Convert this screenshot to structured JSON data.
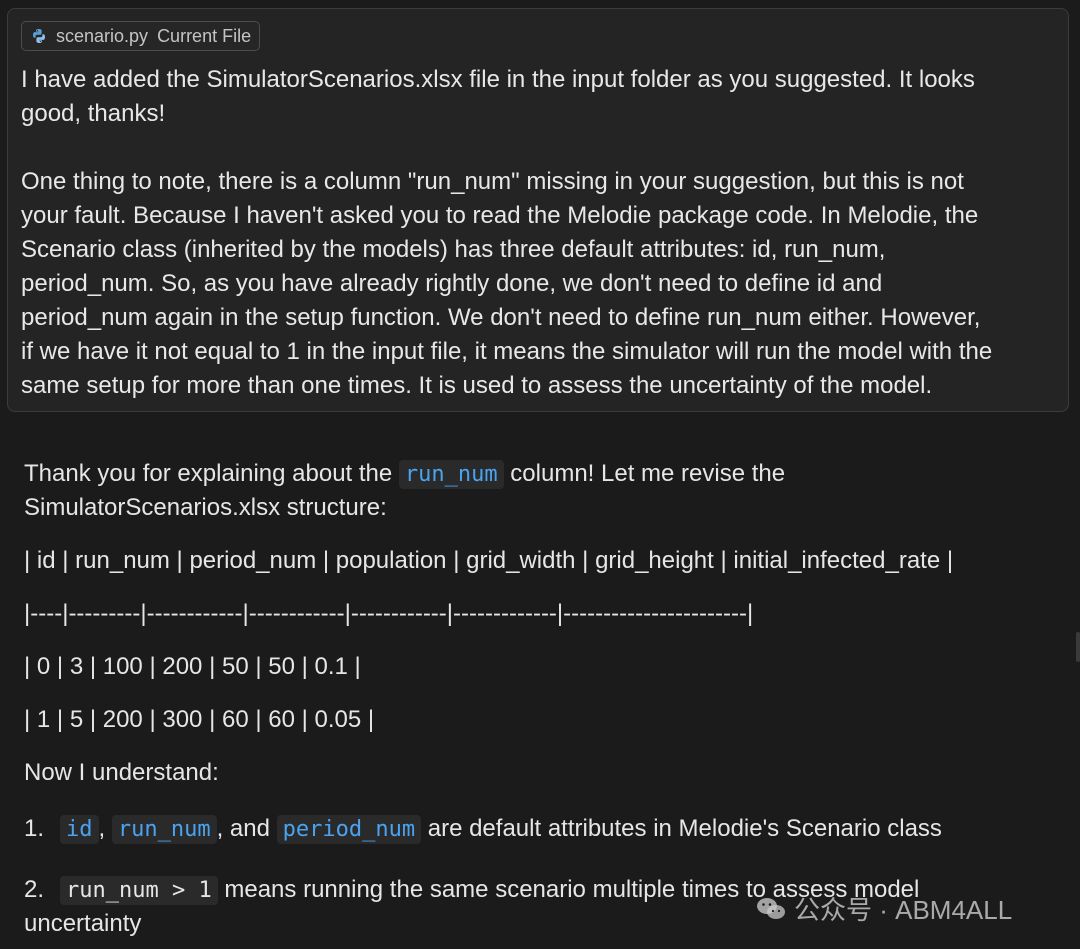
{
  "user_message": {
    "context_file": "scenario.py",
    "context_label": "Current File",
    "file_icon": "python-icon",
    "lines": [
      " I have added the SimulatorScenarios.xlsx file in the input folder as you suggested. It looks",
      "good, thanks!",
      "",
      "One thing to note, there is a column \"run_num\" missing in your suggestion, but this is not",
      "your fault. Because I haven't asked you to read the Melodie package code. In Melodie, the",
      "Scenario class (inherited by the models) has three default attributes: id, run_num,",
      "period_num. So, as you have already rightly done, we don't need to define id and",
      "period_num again in the setup function. We don't need to define run_num either. However,",
      "if we have it not equal to 1 in the input file, it means the simulator will run the model with the",
      "same setup for more than one times. It is used to assess the uncertainty of the model."
    ]
  },
  "assistant": {
    "intro_before": "Thank you for explaining about the ",
    "intro_code": "run_num",
    "intro_after": " column! Let me revise the",
    "intro_line2": "SimulatorScenarios.xlsx structure:",
    "table_header": "| id | run_num | period_num | population | grid_width | grid_height | initial_infected_rate |",
    "table_separator": "|----|---------|------------|------------|------------|-------------|-----------------------|",
    "table_row1": "| 0 | 3 | 100 | 200 | 50 | 50 | 0.1 |",
    "table_row2": "| 1 | 5 | 200 | 300 | 60 | 60 | 0.05 |",
    "understand": "Now I understand:",
    "item1": {
      "number": "1.",
      "code1": "id",
      "sep1": ", ",
      "code2": "run_num",
      "sep2": ", and ",
      "code3": "period_num",
      "rest": " are default attributes in Melodie's Scenario class"
    },
    "item2": {
      "number": "2.",
      "code": "run_num > 1",
      "rest": " means running the same scenario multiple times to assess model",
      "rest_line2": "uncertainty"
    }
  },
  "watermark": {
    "text": "公众号 · ABM4ALL",
    "icon": "wechat-icon"
  },
  "colors": {
    "background": "#1b1b1b",
    "card": "#242424",
    "code_blue": "#4aa3f0",
    "text": "#e6e6e6"
  }
}
